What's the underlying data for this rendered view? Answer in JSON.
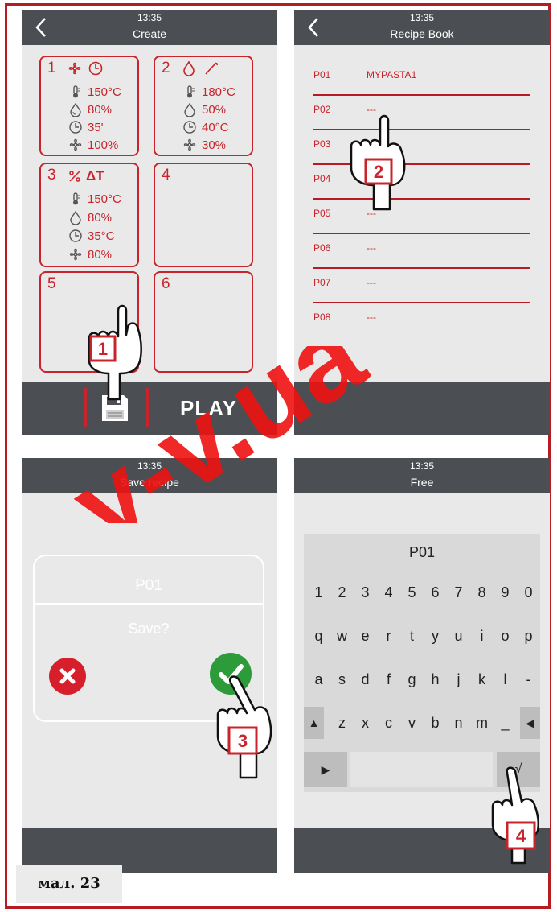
{
  "panel_create": {
    "time": "13:35",
    "title": "Create",
    "slots": [
      {
        "number": "1",
        "rows": [
          "150°C",
          "80%",
          "35'",
          "100%"
        ]
      },
      {
        "number": "2",
        "rows": [
          "180°C",
          "50%",
          "40°C",
          "30%"
        ]
      },
      {
        "number": "3",
        "header_extra": "ΔT",
        "rows": [
          "150°C",
          "80%",
          "35°C",
          "80%"
        ]
      },
      {
        "number": "4"
      },
      {
        "number": "5"
      },
      {
        "number": "6"
      }
    ],
    "play_label": "PLAY",
    "step_badge": "1"
  },
  "panel_recipe_book": {
    "time": "13:35",
    "title": "Recipe Book",
    "recipes": [
      {
        "code": "P01",
        "name": "MYPASTA1"
      },
      {
        "code": "P02",
        "name": "---"
      },
      {
        "code": "P03",
        "name": ""
      },
      {
        "code": "P04",
        "name": ""
      },
      {
        "code": "P05",
        "name": "---"
      },
      {
        "code": "P06",
        "name": "---"
      },
      {
        "code": "P07",
        "name": "---"
      },
      {
        "code": "P08",
        "name": "---"
      }
    ],
    "step_badge": "2"
  },
  "panel_save": {
    "time": "13:35",
    "title": "Save recipe",
    "recipe_code": "P01",
    "question": "Save?",
    "step_badge": "3"
  },
  "panel_keyboard": {
    "time": "13:35",
    "title": "Free",
    "field_value": "P01",
    "row_numbers": [
      "1",
      "2",
      "3",
      "4",
      "5",
      "6",
      "7",
      "8",
      "9",
      "0"
    ],
    "row_q": [
      "q",
      "w",
      "e",
      "r",
      "t",
      "y",
      "u",
      "i",
      "o",
      "p"
    ],
    "row_a": [
      "a",
      "s",
      "d",
      "f",
      "g",
      "h",
      "j",
      "k",
      "l",
      "-"
    ],
    "row_z_shift": "▲",
    "row_z": [
      "z",
      "x",
      "c",
      "v",
      "b",
      "n",
      "m",
      "_"
    ],
    "backspace": "◀",
    "play_key": "▶",
    "confirm_key": "√",
    "step_badge": "4"
  },
  "caption": "мал. 23",
  "watermark": "y-v.ua",
  "colors": {
    "accent": "#c8242b",
    "bar": "#4b4f54",
    "panel": "#e9e9e9",
    "ok": "#2e9b3a",
    "cancel": "#d61f2b"
  }
}
